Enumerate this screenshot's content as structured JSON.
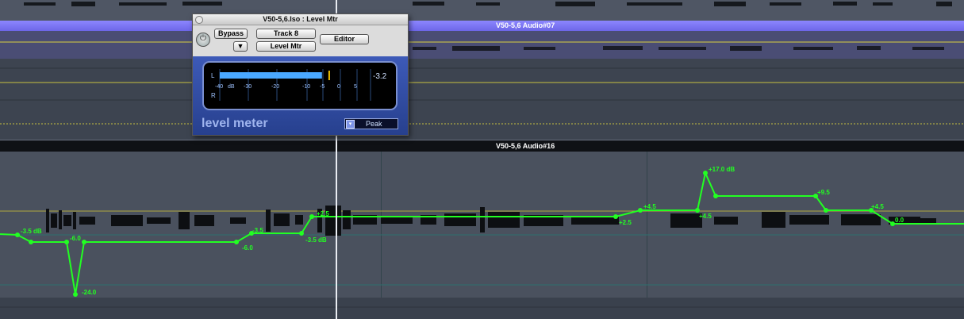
{
  "tracks": {
    "audio07_label": "V50-5,6 Audio#07",
    "audio16_label": "V50-5,6 Audio#16"
  },
  "plugin": {
    "title": "V50-5,6.Iso : Level Mtr",
    "bypass_label": "Bypass",
    "track_label": "Track 8",
    "plugin_name_label": "Level Mtr",
    "editor_label": "Editor",
    "brand_label": "level meter",
    "mode_value": "Peak",
    "meter": {
      "channel_left": "L",
      "channel_right": "R",
      "readout": "-3.2",
      "level_db": -5.3,
      "peak_db": -3.2,
      "scale_labels": [
        "-40",
        "dB",
        "-30",
        "-20",
        "-10",
        "-5",
        "0",
        "5"
      ],
      "bar_color": "#4aa8ff",
      "peak_color": "#f0c000"
    }
  },
  "automation": {
    "color": "#22ff22",
    "labels": [
      "-3.5 dB",
      "-6.0",
      "-24.0",
      "-6.0",
      "-3.5",
      "+2.5",
      "-3.5 dB",
      "+2.5",
      "+4.5",
      "+17.0 dB",
      "+4.5",
      "+9.5",
      "+4.5",
      "0.0"
    ]
  }
}
